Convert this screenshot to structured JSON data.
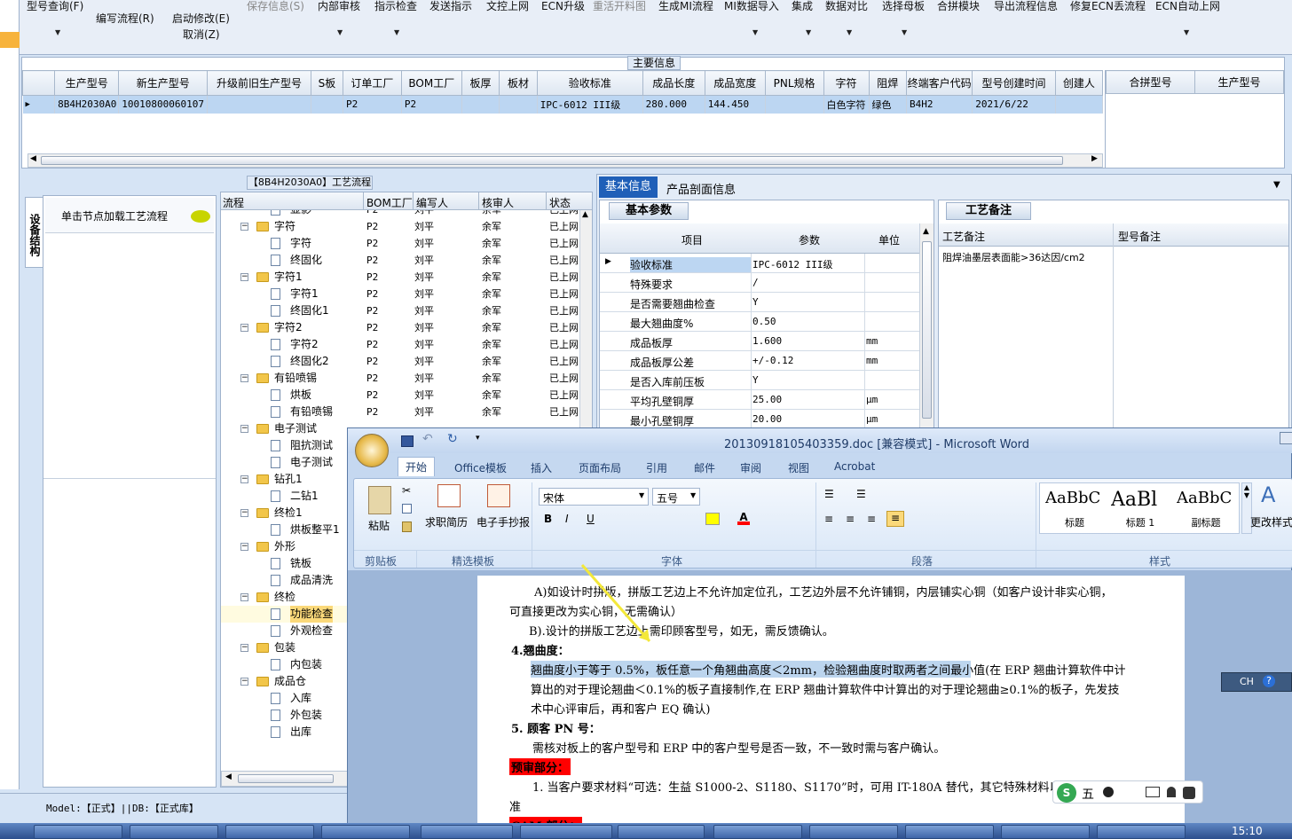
{
  "toolbar": {
    "items": [
      {
        "label": "型号查询(F)",
        "dim": false
      },
      {
        "label": "编写流程(R)",
        "dim": false
      },
      {
        "label": "启动修改(E)",
        "dim": false
      },
      {
        "label": "取消(Z)",
        "dim": false
      },
      {
        "label": "保存信息(S)",
        "dim": true
      },
      {
        "label": "内部审核",
        "dim": false
      },
      {
        "label": "指示检查",
        "dim": false
      },
      {
        "label": "发送指示",
        "dim": false
      },
      {
        "label": "文控上网",
        "dim": false
      },
      {
        "label": "ECN升级",
        "dim": false
      },
      {
        "label": "重活开料图",
        "dim": true
      },
      {
        "label": "生成MI流程",
        "dim": false
      },
      {
        "label": "MI数据导入",
        "dim": false
      },
      {
        "label": "集成",
        "dim": false
      },
      {
        "label": "数据对比",
        "dim": false
      },
      {
        "label": "选择母板",
        "dim": false
      },
      {
        "label": "合拼模块",
        "dim": false
      },
      {
        "label": "导出流程信息",
        "dim": false
      },
      {
        "label": "修复ECN丢流程",
        "dim": false
      },
      {
        "label": "ECN自动上网",
        "dim": false
      }
    ]
  },
  "main_info": {
    "title": "主要信息",
    "columns": [
      "生产型号",
      "新生产型号",
      "升级前旧生产型号",
      "S板",
      "订单工厂",
      "BOM工厂",
      "板厚",
      "板材",
      "验收标准",
      "成品长度",
      "成品宽度",
      "PNL规格",
      "字符",
      "阻焊",
      "终端客户代码",
      "型号创建时间",
      "创建人"
    ],
    "row": [
      "8B4H2030A0",
      "10010800060107",
      "",
      "",
      "P2",
      "P2",
      "",
      "",
      "IPC-6012 III级",
      "280.000",
      "144.450",
      "",
      "白色字符",
      "绿色",
      "B4H2",
      "2021/6/22",
      ""
    ],
    "side_columns": [
      "合拼型号",
      "生产型号"
    ]
  },
  "left_panel": {
    "tab_label": "设备结构",
    "hint": "单击节点加载工艺流程"
  },
  "flow": {
    "title": "【8B4H2030A0】工艺流程",
    "columns": [
      "流程",
      "BOM工厂",
      "编写人",
      "核审人",
      "状态"
    ],
    "rows": [
      {
        "level": 2,
        "type": "doc",
        "name": "显影",
        "factory": "P2",
        "writer": "刘平",
        "checker": "余军",
        "status": "已上网"
      },
      {
        "level": 1,
        "type": "folder",
        "name": "字符",
        "factory": "P2",
        "writer": "刘平",
        "checker": "余军",
        "status": "已上网"
      },
      {
        "level": 2,
        "type": "doc",
        "name": "字符",
        "factory": "P2",
        "writer": "刘平",
        "checker": "余军",
        "status": "已上网"
      },
      {
        "level": 2,
        "type": "doc",
        "name": "终固化",
        "factory": "P2",
        "writer": "刘平",
        "checker": "余军",
        "status": "已上网"
      },
      {
        "level": 1,
        "type": "folder",
        "name": "字符1",
        "factory": "P2",
        "writer": "刘平",
        "checker": "余军",
        "status": "已上网"
      },
      {
        "level": 2,
        "type": "doc",
        "name": "字符1",
        "factory": "P2",
        "writer": "刘平",
        "checker": "余军",
        "status": "已上网"
      },
      {
        "level": 2,
        "type": "doc",
        "name": "终固化1",
        "factory": "P2",
        "writer": "刘平",
        "checker": "余军",
        "status": "已上网"
      },
      {
        "level": 1,
        "type": "folder",
        "name": "字符2",
        "factory": "P2",
        "writer": "刘平",
        "checker": "余军",
        "status": "已上网"
      },
      {
        "level": 2,
        "type": "doc",
        "name": "字符2",
        "factory": "P2",
        "writer": "刘平",
        "checker": "余军",
        "status": "已上网"
      },
      {
        "level": 2,
        "type": "doc",
        "name": "终固化2",
        "factory": "P2",
        "writer": "刘平",
        "checker": "余军",
        "status": "已上网"
      },
      {
        "level": 1,
        "type": "folder",
        "name": "有铅喷锡",
        "factory": "P2",
        "writer": "刘平",
        "checker": "余军",
        "status": "已上网"
      },
      {
        "level": 2,
        "type": "doc",
        "name": "烘板",
        "factory": "P2",
        "writer": "刘平",
        "checker": "余军",
        "status": "已上网"
      },
      {
        "level": 2,
        "type": "doc",
        "name": "有铅喷锡",
        "factory": "P2",
        "writer": "刘平",
        "checker": "余军",
        "status": "已上网"
      },
      {
        "level": 1,
        "type": "folder",
        "name": "电子测试",
        "factory": "",
        "writer": "",
        "checker": "",
        "status": ""
      },
      {
        "level": 2,
        "type": "doc",
        "name": "阻抗测试",
        "factory": "",
        "writer": "",
        "checker": "",
        "status": ""
      },
      {
        "level": 2,
        "type": "doc",
        "name": "电子测试",
        "factory": "",
        "writer": "",
        "checker": "",
        "status": ""
      },
      {
        "level": 1,
        "type": "folder",
        "name": "钻孔1",
        "factory": "",
        "writer": "",
        "checker": "",
        "status": ""
      },
      {
        "level": 2,
        "type": "doc",
        "name": "二钻1",
        "factory": "",
        "writer": "",
        "checker": "",
        "status": ""
      },
      {
        "level": 1,
        "type": "folder",
        "name": "终检1",
        "factory": "",
        "writer": "",
        "checker": "",
        "status": ""
      },
      {
        "level": 2,
        "type": "doc",
        "name": "烘板整平1",
        "factory": "",
        "writer": "",
        "checker": "",
        "status": ""
      },
      {
        "level": 1,
        "type": "folder",
        "name": "外形",
        "factory": "",
        "writer": "",
        "checker": "",
        "status": ""
      },
      {
        "level": 2,
        "type": "doc",
        "name": "铣板",
        "factory": "",
        "writer": "",
        "checker": "",
        "status": ""
      },
      {
        "level": 2,
        "type": "doc",
        "name": "成品清洗",
        "factory": "",
        "writer": "",
        "checker": "",
        "status": ""
      },
      {
        "level": 1,
        "type": "folder",
        "name": "终检",
        "factory": "",
        "writer": "",
        "checker": "",
        "status": ""
      },
      {
        "level": 2,
        "type": "doc",
        "name": "功能检查",
        "factory": "",
        "writer": "",
        "checker": "",
        "status": "",
        "selected": true
      },
      {
        "level": 2,
        "type": "doc",
        "name": "外观检查",
        "factory": "",
        "writer": "",
        "checker": "",
        "status": ""
      },
      {
        "level": 1,
        "type": "folder",
        "name": "包装",
        "factory": "",
        "writer": "",
        "checker": "",
        "status": ""
      },
      {
        "level": 2,
        "type": "doc",
        "name": "内包装",
        "factory": "",
        "writer": "",
        "checker": "",
        "status": ""
      },
      {
        "level": 1,
        "type": "folder",
        "name": "成品仓",
        "factory": "",
        "writer": "",
        "checker": "",
        "status": ""
      },
      {
        "level": 2,
        "type": "doc",
        "name": "入库",
        "factory": "",
        "writer": "",
        "checker": "",
        "status": ""
      },
      {
        "level": 2,
        "type": "doc",
        "name": "外包装",
        "factory": "",
        "writer": "",
        "checker": "",
        "status": ""
      },
      {
        "level": 2,
        "type": "doc",
        "name": "出库",
        "factory": "",
        "writer": "",
        "checker": "",
        "status": ""
      }
    ]
  },
  "right_tabs": {
    "tabs": [
      "基本信息",
      "产品剖面信息"
    ],
    "sub_tab": "基本参数",
    "param_columns": [
      "项目",
      "参数",
      "单位"
    ],
    "params": [
      {
        "item": "验收标准",
        "value": "IPC-6012 III级",
        "unit": ""
      },
      {
        "item": "特殊要求",
        "value": "/",
        "unit": ""
      },
      {
        "item": "是否需要翘曲检查",
        "value": "Y",
        "unit": ""
      },
      {
        "item": "最大翘曲度%",
        "value": "0.50",
        "unit": ""
      },
      {
        "item": "成品板厚",
        "value": "1.600",
        "unit": "mm"
      },
      {
        "item": "成品板厚公差",
        "value": "+/-0.12",
        "unit": "mm"
      },
      {
        "item": "是否入库前压板",
        "value": "Y",
        "unit": ""
      },
      {
        "item": "平均孔壁铜厚",
        "value": "25.00",
        "unit": "μm"
      },
      {
        "item": "最小孔壁铜厚",
        "value": "20.00",
        "unit": "μm"
      }
    ],
    "remark_tab": "工艺备注",
    "remark_columns": [
      "工艺备注",
      "型号备注"
    ],
    "remark_text": "阻焊油墨层表面能>36达因/cm2"
  },
  "statusbar": {
    "text": "Model:【正式】||DB:【正式库】"
  },
  "word": {
    "title": "20130918105403359.doc [兼容模式] - Microsoft Word",
    "tabs": [
      "开始",
      "Office模板",
      "插入",
      "页面布局",
      "引用",
      "邮件",
      "审阅",
      "视图",
      "Acrobat"
    ],
    "paste": "粘贴",
    "clip_label": "剪贴板",
    "tpl1": "求职简历",
    "tpl2": "电子手抄报",
    "tpl_label": "精选模板",
    "font_name": "宋体",
    "font_size": "五号",
    "font_label": "字体",
    "para_label": "段落",
    "styles": [
      {
        "sample": "AaBbC",
        "name": "标题"
      },
      {
        "sample": "AaBl",
        "name": "标题 1"
      },
      {
        "sample": "AaBbC",
        "name": "副标题"
      }
    ],
    "style_label": "样式",
    "change_style": "更改样式",
    "doc_lines": [
      "A)如设计时拼版，拼版工艺边上不允许加定位孔，工艺边外层不允许铺铜，内层铺实心铜（如客户设计非实心铜，",
      "可直接更改为实心铜，无需确认）",
      "B).设计的拼版工艺边上需印顾客型号，如无，需反馈确认。",
      "4.翘曲度：",
      "翘曲度小于等于 0.5%，板任意一个角翘曲高度＜2mm，检验翘曲度时取两者之间最小值(在 ERP 翘曲计算软件中计",
      "算出的对于理论翘曲＜0.1%的板子直接制作,在 ERP 翘曲计算软件中计算出的对于理论翘曲≥0.1%的板子，先发技",
      "术中心评审后，再和客户 EQ 确认)",
      "5. 顾客 PN 号：",
      "需核对板上的客户型号和 ERP 中的客户型号是否一致，不一致时需与客户确认。",
      "预审部分：",
      "1. 当客户要求材料“可选：生益 S1000-2、S1180、S1170”时，可用 IT-180A 替代，其它特殊材料以客户要求为",
      "准",
      "CAM 部分："
    ]
  },
  "ime": {
    "lang": "CH",
    "mode": "五"
  },
  "taskbar": {
    "time": "15:10"
  },
  "colors": {
    "accent": "#1f5fb8",
    "selection": "#bcd6f2",
    "red_label": "#ff0000",
    "highlight": "#bcd5ee"
  }
}
